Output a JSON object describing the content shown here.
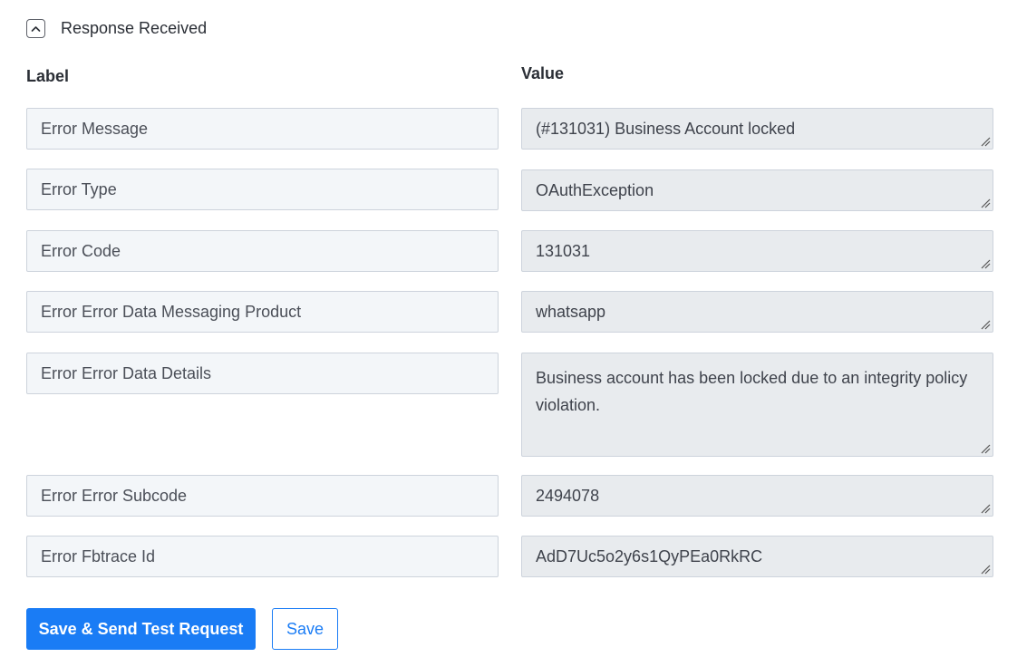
{
  "section": {
    "title": "Response Received",
    "toggle_icon": "chevron-up-icon"
  },
  "columns": {
    "label": "Label",
    "value": "Value"
  },
  "rows": [
    {
      "label": "Error Message",
      "value": "(#131031) Business Account locked"
    },
    {
      "label": "Error Type",
      "value": "OAuthException"
    },
    {
      "label": "Error Code",
      "value": "131031"
    },
    {
      "label": "Error Error Data Messaging Product",
      "value": "whatsapp"
    },
    {
      "label": "Error Error Data Details",
      "value": "Business account has been locked due to an integrity policy violation."
    },
    {
      "label": "Error Error Subcode",
      "value": "2494078"
    },
    {
      "label": "Error Fbtrace Id",
      "value": "AdD7Uc5o2y6s1QyPEa0RkRC"
    }
  ],
  "actions": {
    "save_send_label": "Save & Send Test Request",
    "save_label": "Save"
  },
  "colors": {
    "primary": "#1a7cf5",
    "label_bg": "#f3f6f9",
    "value_bg": "#e8ebee"
  }
}
